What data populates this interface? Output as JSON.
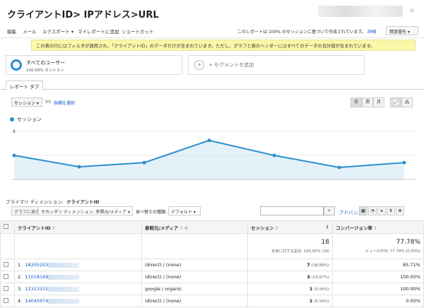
{
  "header": {
    "title": "クライアントID> IPアドレス>URL"
  },
  "toolbar": {
    "items": [
      "編集",
      "メール",
      "エクスポート ▾",
      "マイレポートに追加",
      "ショートカット"
    ],
    "note": "このレポートは 100% のセッションに基づいて作成されています。",
    "detail_link": "詳細",
    "mode": "精度優先"
  },
  "notice": "この表の行にはフィルタが適用され、「クライアントID」のデータだけが含まれています。ただし、グラフと表のヘッダーにはすべてのデータの合計値が含まれています。",
  "segments": {
    "active_name": "すべてのユーザー",
    "active_sub": "100.00% セッション",
    "add_label": "+ セグメントを追加"
  },
  "tab": "レポート タブ",
  "chart_controls": {
    "metric": "セッション",
    "vs": "VS",
    "add_metric": "指標を選択",
    "periods": [
      "日",
      "週",
      "月"
    ]
  },
  "chart_data": {
    "type": "line",
    "series": [
      {
        "name": "セッション",
        "values": [
          4,
          2.1,
          2.8,
          6.5,
          4,
          2,
          2.8
        ]
      }
    ],
    "yticks": [
      4,
      8
    ],
    "ylim": [
      0,
      8
    ],
    "color": "#2b8fcf"
  },
  "primary_dimension": {
    "label": "プライマリ ディメンション:",
    "value": "クライアントID"
  },
  "filters": {
    "graph_btn": "グラフに表示",
    "secondary": "セカンダリ ディメンション: 参照元/メディア",
    "sort_label": "並べ替えの種類:",
    "sort_value": "デフォルト",
    "advanced": "アドバンス"
  },
  "table": {
    "headers": {
      "client": "クライアントID",
      "source": "参照元/メディア",
      "sessions": "セッション",
      "conv": "コンバージョン率"
    },
    "totals": {
      "sessions": "18",
      "sessions_sub": "全体に対する割合: 100.00% (18)",
      "conv": "77.78%",
      "conv_sub": "ビューの平均: 77.78% (0.00%)"
    },
    "rows": [
      {
        "idx": "1.",
        "id": "18205203",
        "source": "(direct) / (none)",
        "sessions": "7",
        "pct": "(38.89%)",
        "conv": "85.71%"
      },
      {
        "idx": "2.",
        "id": "11018169",
        "source": "(direct) / (none)",
        "sessions": "3",
        "pct": "(16.67%)",
        "conv": "100.00%"
      },
      {
        "idx": "3.",
        "id": "12313331",
        "source": "google / organic",
        "sessions": "1",
        "pct": "(5.56%)",
        "conv": "100.00%"
      },
      {
        "idx": "4.",
        "id": "14045974",
        "source": "(direct) / (none)",
        "sessions": "1",
        "pct": "(5.56%)",
        "conv": "0.00%"
      }
    ]
  }
}
